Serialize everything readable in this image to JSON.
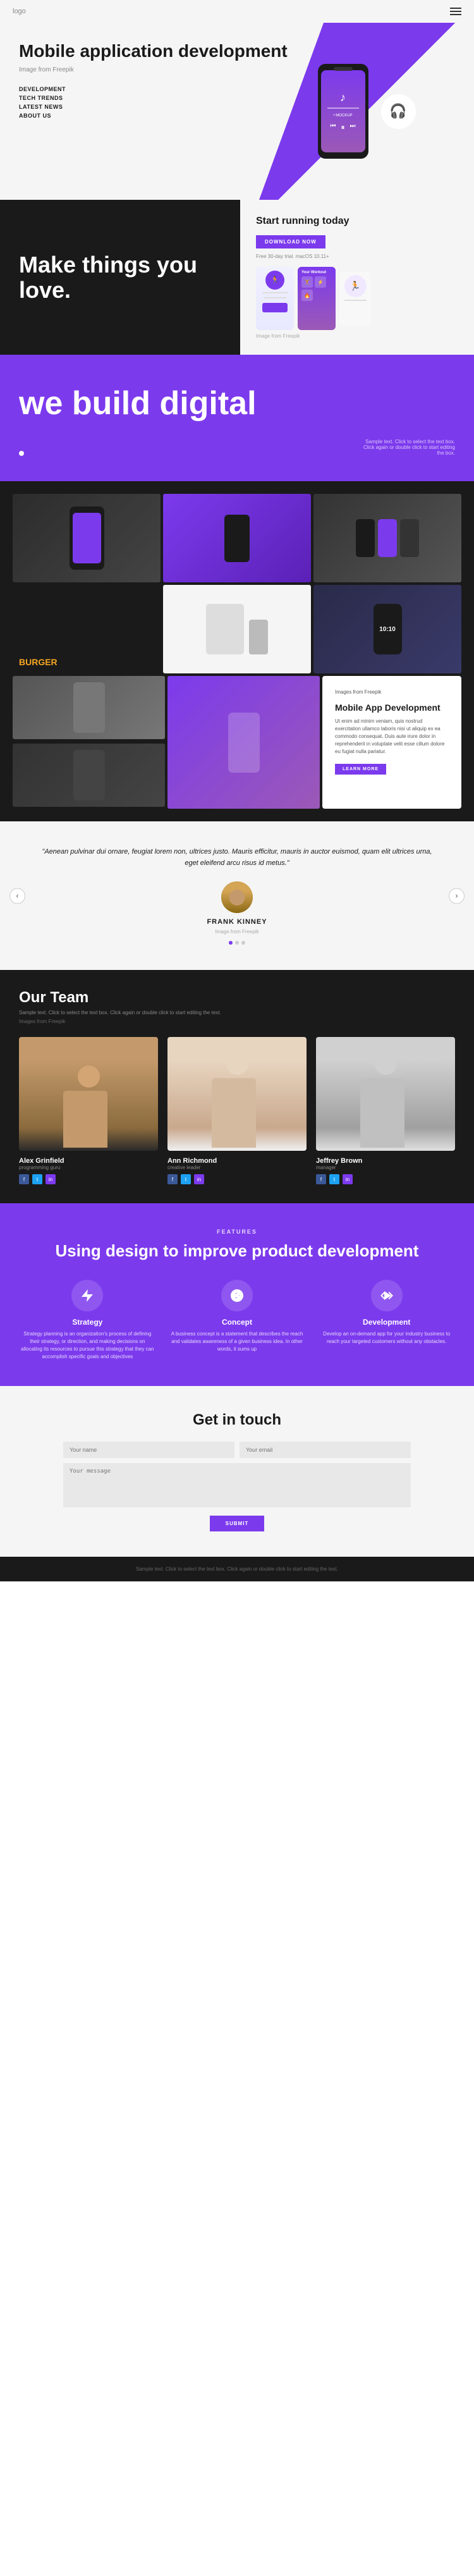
{
  "header": {
    "logo": "logo",
    "menu_icon": "≡"
  },
  "hero": {
    "title": "Mobile application development",
    "image_credit": "Image from Freepik",
    "mockup_label": "• MOCKUP",
    "nav": {
      "items": [
        {
          "label": "DEVELOPMENT"
        },
        {
          "label": "TECH TRENDS"
        },
        {
          "label": "LATEST NEWS"
        },
        {
          "label": "ABOUT US"
        }
      ]
    }
  },
  "section_make": {
    "title": "Make things you love.",
    "running": {
      "title": "Start running today",
      "button": "DOWNLOAD NOW",
      "trial": "Free 30-day trial. macOS 10.11+",
      "image_credit": "Image from Freepik"
    }
  },
  "section_build": {
    "title": "we build digital",
    "sample_text": "Sample text. Click to select the text box. Click again or double click to start editing the box."
  },
  "section_portfolio": {
    "burger_text": "BURGER",
    "card": {
      "title": "Mobile App Development",
      "description": "Ut enim ad minim veniam, quis nostrud exercitation ullamco laboris nisi ut aliquip ex ea commodo consequat. Duis aute irure dolor in reprehenderit in voluptate velit esse cillum dolore eu fugiat nulla pariatur.",
      "image_credit": "Images from Freepik",
      "button": "LEARN MORE"
    }
  },
  "testimonial": {
    "quote": "Aenean pulvinar dui ornare, feugiat lorem non, ultrices justo. Mauris efficitur, mauris in auctor euismod, quam elit ultrices urna, eget eleifend arcu risus id metus.",
    "name": "FRANK KINNEY",
    "role": "Image from Freepik",
    "dots": [
      true,
      false,
      false
    ]
  },
  "team": {
    "title": "Our Team",
    "description": "Sample text. Click to select the text box. Click again or double click to start editing the text.",
    "image_credit": "Images from Freepik",
    "members": [
      {
        "name": "Alex Grinfield",
        "role": "programming guru",
        "socials": [
          "f",
          "t",
          "in"
        ]
      },
      {
        "name": "Ann Richmond",
        "role": "creative leader",
        "socials": [
          "f",
          "t",
          "in"
        ]
      },
      {
        "name": "Jeffrey Brown",
        "role": "manager",
        "socials": [
          "f",
          "t",
          "in"
        ]
      }
    ]
  },
  "features": {
    "label": "FEATURES",
    "title": "Using design to improve product development",
    "items": [
      {
        "icon": "⚡",
        "name": "Strategy",
        "description": "Strategy planning is an organization's process of defining their strategy, or direction, and making decisions on allocating its resources to pursue this strategy that they can accomplish specific goals and objectives"
      },
      {
        "icon": "🌐",
        "name": "Concept",
        "description": "A business concept is a statement that describes the reach and validates awareness of a given business idea. In other words, it sums up"
      },
      {
        "icon": "</>",
        "name": "Development",
        "description": "Develop an on-demand app for your industry business to reach your targeted customers without any obstacles."
      }
    ]
  },
  "contact": {
    "title": "Get in touch",
    "fields": {
      "name_placeholder": "Your name",
      "email_placeholder": "Your email",
      "message_placeholder": "Your message"
    },
    "submit": "SUBMIT"
  },
  "footer": {
    "text": "Sample text. Click to select the text box. Click again or double click to start editing the text."
  }
}
